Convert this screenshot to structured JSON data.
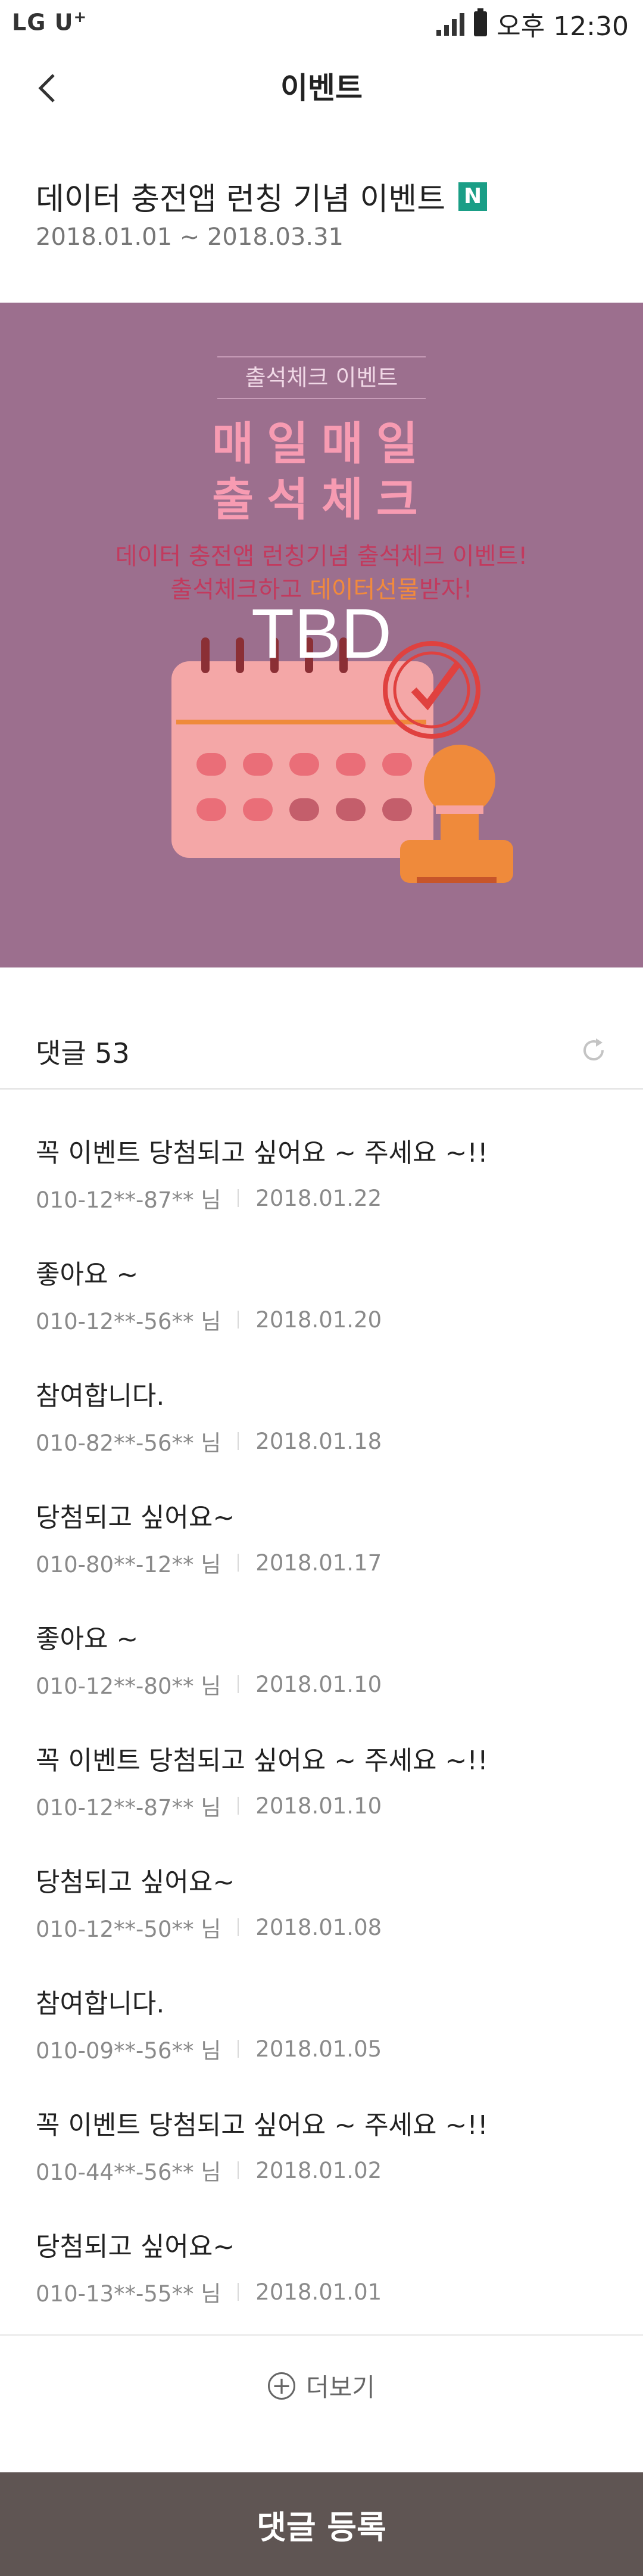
{
  "status_bar": {
    "carrier": "LG U",
    "carrier_plus": "+",
    "time": "오후 12:30"
  },
  "header": {
    "title": "이벤트"
  },
  "event": {
    "title": "데이터 충전앱 런칭 기념 이벤트",
    "badge": "N",
    "date_range": "2018.01.01 ~ 2018.03.31"
  },
  "banner": {
    "tag": "출석체크 이벤트",
    "headline_1": "매일매일",
    "headline_2": "출석체크",
    "sub_1": "데이터 충전앱 런칭기념 출석체크 이벤트!",
    "sub_2_pre": "출석체크하고 ",
    "sub_2_highlight": "데이터선물",
    "sub_2_post": "받자!",
    "placeholder": "TBD"
  },
  "comments": {
    "label": "댓글",
    "count": "53",
    "items": [
      {
        "text": "꼭 이벤트 당첨되고 싶어요 ~ 주세요 ~!!",
        "user": "010-12**-87** 님",
        "date": "2018.01.22"
      },
      {
        "text": "좋아요 ~",
        "user": "010-12**-56** 님",
        "date": "2018.01.20"
      },
      {
        "text": "참여합니다.",
        "user": "010-82**-56** 님",
        "date": "2018.01.18"
      },
      {
        "text": "당첨되고 싶어요~",
        "user": "010-80**-12** 님",
        "date": "2018.01.17"
      },
      {
        "text": "좋아요 ~",
        "user": "010-12**-80** 님",
        "date": "2018.01.10"
      },
      {
        "text": "꼭 이벤트 당첨되고 싶어요 ~ 주세요 ~!!",
        "user": "010-12**-87** 님",
        "date": "2018.01.10"
      },
      {
        "text": "당첨되고 싶어요~",
        "user": "010-12**-50** 님",
        "date": "2018.01.08"
      },
      {
        "text": "참여합니다.",
        "user": "010-09**-56** 님",
        "date": "2018.01.05"
      },
      {
        "text": "꼭 이벤트 당첨되고 싶어요 ~ 주세요 ~!!",
        "user": "010-44**-56** 님",
        "date": "2018.01.02"
      },
      {
        "text": "당첨되고 싶어요~",
        "user": "010-13**-55** 님",
        "date": "2018.01.01"
      }
    ],
    "more_label": "더보기"
  },
  "footer": {
    "submit_label": "댓글 등록"
  },
  "colors": {
    "banner_bg": "#9c6f8e",
    "badge": "#1a9e86",
    "submit_bg": "#5f5553",
    "highlight": "#f28a3c"
  },
  "icons": [
    "back-arrow-icon",
    "refresh-icon",
    "plus-circle-icon",
    "signal-icon",
    "battery-icon",
    "check-stamp-icon",
    "calendar-icon"
  ]
}
